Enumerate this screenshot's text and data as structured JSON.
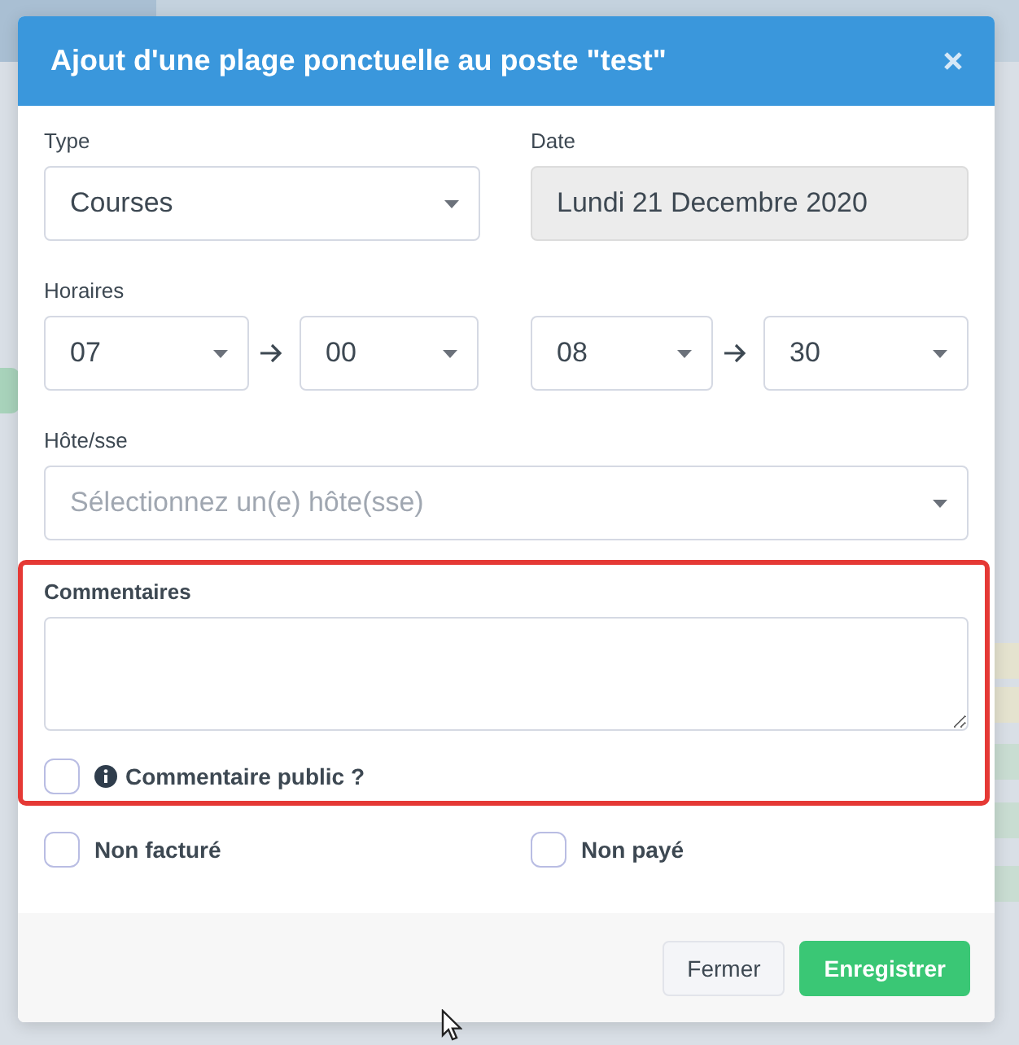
{
  "dialog": {
    "title": "Ajout d'une plage ponctuelle au poste \"test\"",
    "type": {
      "label": "Type",
      "value": "Courses"
    },
    "date": {
      "label": "Date",
      "value": "Lundi 21 Decembre 2020",
      "disabled": true
    },
    "hours": {
      "label": "Horaires",
      "start_hour": "07",
      "start_minute": "00",
      "end_hour": "08",
      "end_minute": "30"
    },
    "host": {
      "label": "Hôte/sse",
      "placeholder": "Sélectionnez un(e) hôte(sse)"
    },
    "comments": {
      "label": "Commentaires",
      "highlighted": true,
      "public_label": "Commentaire public ?",
      "public_checked": false
    },
    "flags": [
      {
        "label": "Non facturé",
        "checked": false
      },
      {
        "label": "Non payé",
        "checked": false
      }
    ],
    "buttons": [
      {
        "label": "Fermer",
        "kind": "secondary"
      },
      {
        "label": "Enregistrer",
        "kind": "primary"
      }
    ]
  }
}
